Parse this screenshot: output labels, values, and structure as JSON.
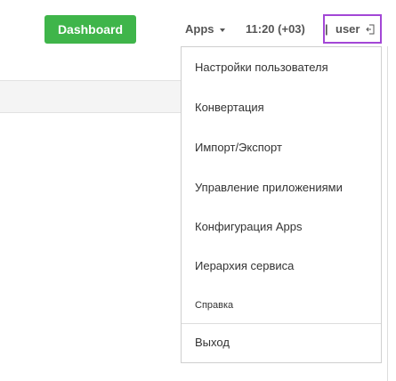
{
  "navbar": {
    "dashboard_label": "Dashboard",
    "apps_label": "Apps",
    "clock": "11:20 (+03)",
    "separator": "|",
    "user_label": "user",
    "colors": {
      "dashboard_bg": "#3fb54a",
      "highlight_border": "#a347d6"
    },
    "icons": {
      "apps_caret": "caret-down-icon",
      "logout": "logout-icon"
    }
  },
  "user_menu": {
    "items": [
      "Настройки пользователя",
      "Конвертация",
      "Импорт/Экспорт",
      "Управление приложениями",
      "Конфигурация Apps",
      "Иерархия сервиса",
      "Справка"
    ],
    "logout_label": "Выход"
  }
}
